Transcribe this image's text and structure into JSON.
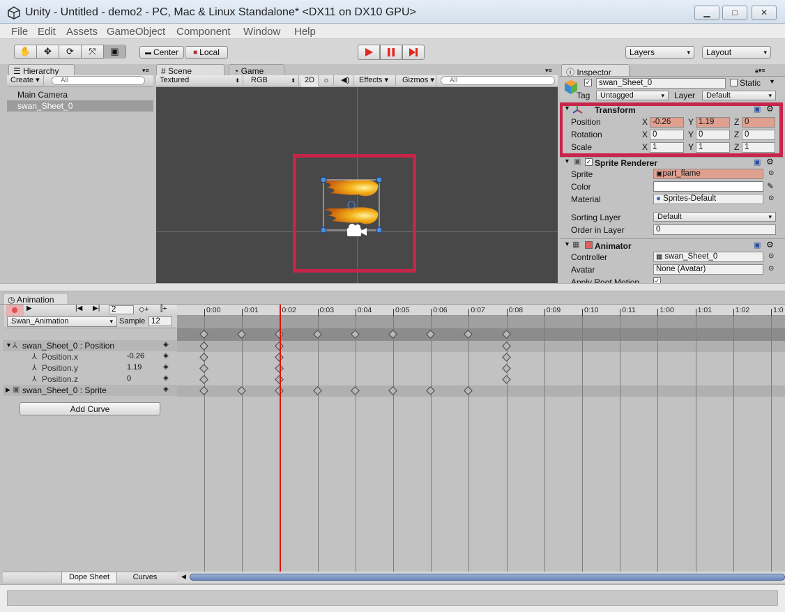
{
  "window": {
    "title": "Unity - Untitled - demo2 - PC, Mac & Linux Standalone* <DX11 on DX10 GPU>",
    "min": "▁",
    "max": "□",
    "close": "✕"
  },
  "menu": [
    "File",
    "Edit",
    "Assets",
    "GameObject",
    "Component",
    "Window",
    "Help"
  ],
  "toolbar": {
    "center": "Center",
    "local": "Local",
    "layers": "Layers",
    "layout": "Layout"
  },
  "hierarchy": {
    "tab": "Hierarchy",
    "create": "Create",
    "search": "All",
    "items": [
      "Main Camera",
      "swan_Sheet_0"
    ]
  },
  "scene": {
    "tab": "Scene",
    "game_tab": "Game",
    "shading": "Textured",
    "render": "RGB",
    "mode2d": "2D",
    "effects": "Effects",
    "gizmos": "Gizmos",
    "search": "All"
  },
  "inspector": {
    "tab": "Inspector",
    "object_name": "swan_Sheet_0",
    "static": "Static",
    "tag_label": "Tag",
    "tag_value": "Untagged",
    "layer_label": "Layer",
    "layer_value": "Default",
    "transform": {
      "title": "Transform",
      "position": "Position",
      "rotation": "Rotation",
      "scale": "Scale",
      "px": "-0.26",
      "py": "1.19",
      "pz": "0",
      "rx": "0",
      "ry": "0",
      "rz": "0",
      "sx": "1",
      "sy": "1",
      "sz": "1",
      "x": "X",
      "y": "Y",
      "z": "Z"
    },
    "sprite_renderer": {
      "title": "Sprite Renderer",
      "sprite_label": "Sprite",
      "sprite_value": "part_flame",
      "color_label": "Color",
      "material_label": "Material",
      "material_value": "Sprites-Default",
      "sorting_label": "Sorting Layer",
      "sorting_value": "Default",
      "order_label": "Order in Layer",
      "order_value": "0"
    },
    "animator": {
      "title": "Animator",
      "controller_label": "Controller",
      "controller_value": "swan_Sheet_0",
      "avatar_label": "Avatar",
      "avatar_value": "None (Avatar)",
      "root_motion_label": "Apply Root Motion"
    }
  },
  "animation": {
    "tab": "Animation",
    "frame": "2",
    "clip": "Swan_Animation",
    "sample_label": "Sample",
    "sample_value": "12",
    "tracks": [
      {
        "name": "swan_Sheet_0 : Position",
        "value": ""
      },
      {
        "name": "Position.x",
        "value": "-0.26"
      },
      {
        "name": "Position.y",
        "value": "1.19"
      },
      {
        "name": "Position.z",
        "value": "0"
      },
      {
        "name": "swan_Sheet_0 : Sprite",
        "value": ""
      }
    ],
    "add_curve": "Add Curve",
    "dope_sheet": "Dope Sheet",
    "curves": "Curves",
    "ticks": [
      "0:00",
      "0:01",
      "0:02",
      "0:03",
      "0:04",
      "0:05",
      "0:06",
      "0:07",
      "0:08",
      "0:09",
      "0:10",
      "0:11",
      "1:00",
      "1:01",
      "1:02",
      "1:0"
    ]
  },
  "colors": {
    "highlight": "#c8244a",
    "record": "#e05050",
    "playhead": "#e01010",
    "play": "#e0281e"
  }
}
